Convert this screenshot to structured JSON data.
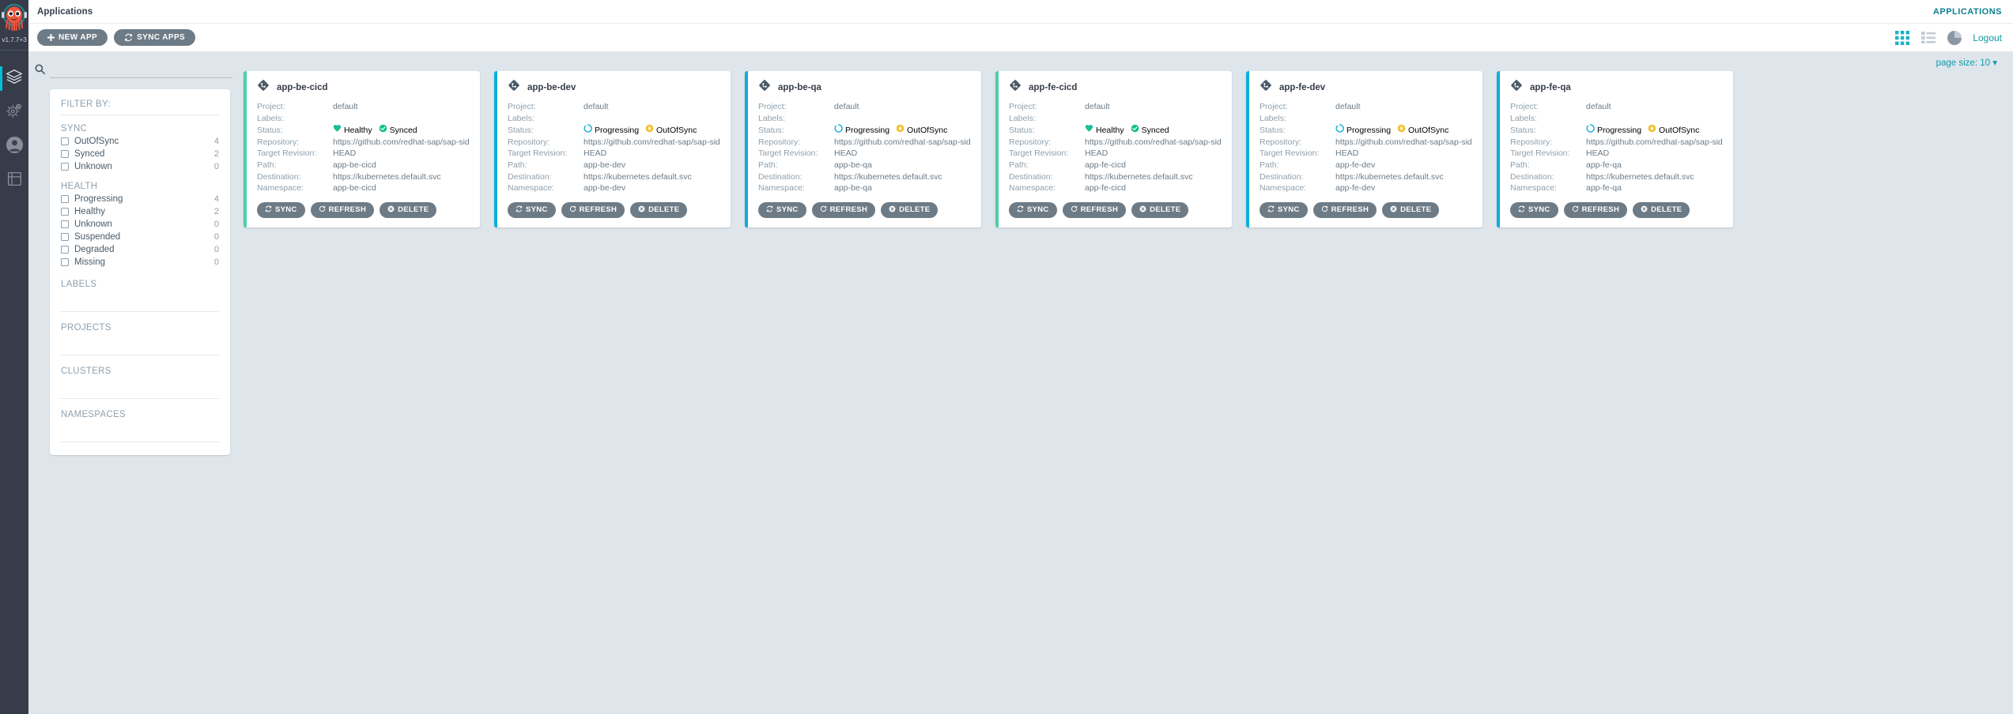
{
  "rail": {
    "version": "v1.7.7+3",
    "items": [
      {
        "name": "applications",
        "icon": "layers-icon",
        "active": true
      },
      {
        "name": "settings",
        "icon": "gear-icon",
        "active": false
      },
      {
        "name": "user-info",
        "icon": "user-icon",
        "active": false
      },
      {
        "name": "documentation",
        "icon": "book-icon",
        "active": false
      }
    ]
  },
  "topbar": {
    "title": "Applications",
    "section": "APPLICATIONS"
  },
  "toolbar": {
    "new_app_label": "NEW APP",
    "sync_apps_label": "SYNC APPS",
    "logout_label": "Logout",
    "views": [
      {
        "name": "tiles-view-icon",
        "active": true
      },
      {
        "name": "list-view-icon",
        "active": false
      },
      {
        "name": "summary-pie-view-icon",
        "active": false
      }
    ]
  },
  "search": {
    "value": "",
    "placeholder": ""
  },
  "filters": {
    "title": "FILTER BY:",
    "groups": [
      {
        "title": "SYNC",
        "options": [
          {
            "label": "OutOfSync",
            "count": "4"
          },
          {
            "label": "Synced",
            "count": "2"
          },
          {
            "label": "Unknown",
            "count": "0"
          }
        ]
      },
      {
        "title": "HEALTH",
        "options": [
          {
            "label": "Progressing",
            "count": "4"
          },
          {
            "label": "Healthy",
            "count": "2"
          },
          {
            "label": "Unknown",
            "count": "0"
          },
          {
            "label": "Suspended",
            "count": "0"
          },
          {
            "label": "Degraded",
            "count": "0"
          },
          {
            "label": "Missing",
            "count": "0"
          }
        ]
      }
    ],
    "sections": [
      "LABELS",
      "PROJECTS",
      "CLUSTERS",
      "NAMESPACES"
    ]
  },
  "page_size": {
    "label": "page size: 10"
  },
  "card_labels": {
    "project": "Project:",
    "labels": "Labels:",
    "status": "Status:",
    "repository": "Repository:",
    "target_revision": "Target Revision:",
    "path": "Path:",
    "destination": "Destination:",
    "namespace": "Namespace:"
  },
  "card_actions": {
    "sync": "SYNC",
    "refresh": "REFRESH",
    "delete": "DELETE"
  },
  "colors": {
    "healthy": "#18be94",
    "synced": "#18be94",
    "progressing": "#0daeda",
    "outofsync": "#f4c030",
    "accent": "#0d9aa8",
    "button": "#6d7b86"
  },
  "applications": [
    {
      "name": "app-be-cicd",
      "project": "default",
      "labels": "",
      "health": "Healthy",
      "sync": "Synced",
      "health_state": "healthy",
      "sync_state": "synced",
      "repository": "https://github.com/redhat-sap/sap-side-by-side-ci.git",
      "target_revision": "HEAD",
      "path": "app-be-cicd",
      "destination": "https://kubernetes.default.svc",
      "namespace": "app-be-cicd"
    },
    {
      "name": "app-be-dev",
      "project": "default",
      "labels": "",
      "health": "Progressing",
      "sync": "OutOfSync",
      "health_state": "progressing",
      "sync_state": "outofsync",
      "repository": "https://github.com/redhat-sap/sap-side-by-side-ci.git",
      "target_revision": "HEAD",
      "path": "app-be-dev",
      "destination": "https://kubernetes.default.svc",
      "namespace": "app-be-dev"
    },
    {
      "name": "app-be-qa",
      "project": "default",
      "labels": "",
      "health": "Progressing",
      "sync": "OutOfSync",
      "health_state": "progressing",
      "sync_state": "outofsync",
      "repository": "https://github.com/redhat-sap/sap-side-by-side-ci.git",
      "target_revision": "HEAD",
      "path": "app-be-qa",
      "destination": "https://kubernetes.default.svc",
      "namespace": "app-be-qa"
    },
    {
      "name": "app-fe-cicd",
      "project": "default",
      "labels": "",
      "health": "Healthy",
      "sync": "Synced",
      "health_state": "healthy",
      "sync_state": "synced",
      "repository": "https://github.com/redhat-sap/sap-side-by-side-ci.git",
      "target_revision": "HEAD",
      "path": "app-fe-cicd",
      "destination": "https://kubernetes.default.svc",
      "namespace": "app-fe-cicd"
    },
    {
      "name": "app-fe-dev",
      "project": "default",
      "labels": "",
      "health": "Progressing",
      "sync": "OutOfSync",
      "health_state": "progressing",
      "sync_state": "outofsync",
      "repository": "https://github.com/redhat-sap/sap-side-by-side-ci.git",
      "target_revision": "HEAD",
      "path": "app-fe-dev",
      "destination": "https://kubernetes.default.svc",
      "namespace": "app-fe-dev"
    },
    {
      "name": "app-fe-qa",
      "project": "default",
      "labels": "",
      "health": "Progressing",
      "sync": "OutOfSync",
      "health_state": "progressing",
      "sync_state": "outofsync",
      "repository": "https://github.com/redhat-sap/sap-side-by-side-ci.git",
      "target_revision": "HEAD",
      "path": "app-fe-qa",
      "destination": "https://kubernetes.default.svc",
      "namespace": "app-fe-qa"
    }
  ]
}
